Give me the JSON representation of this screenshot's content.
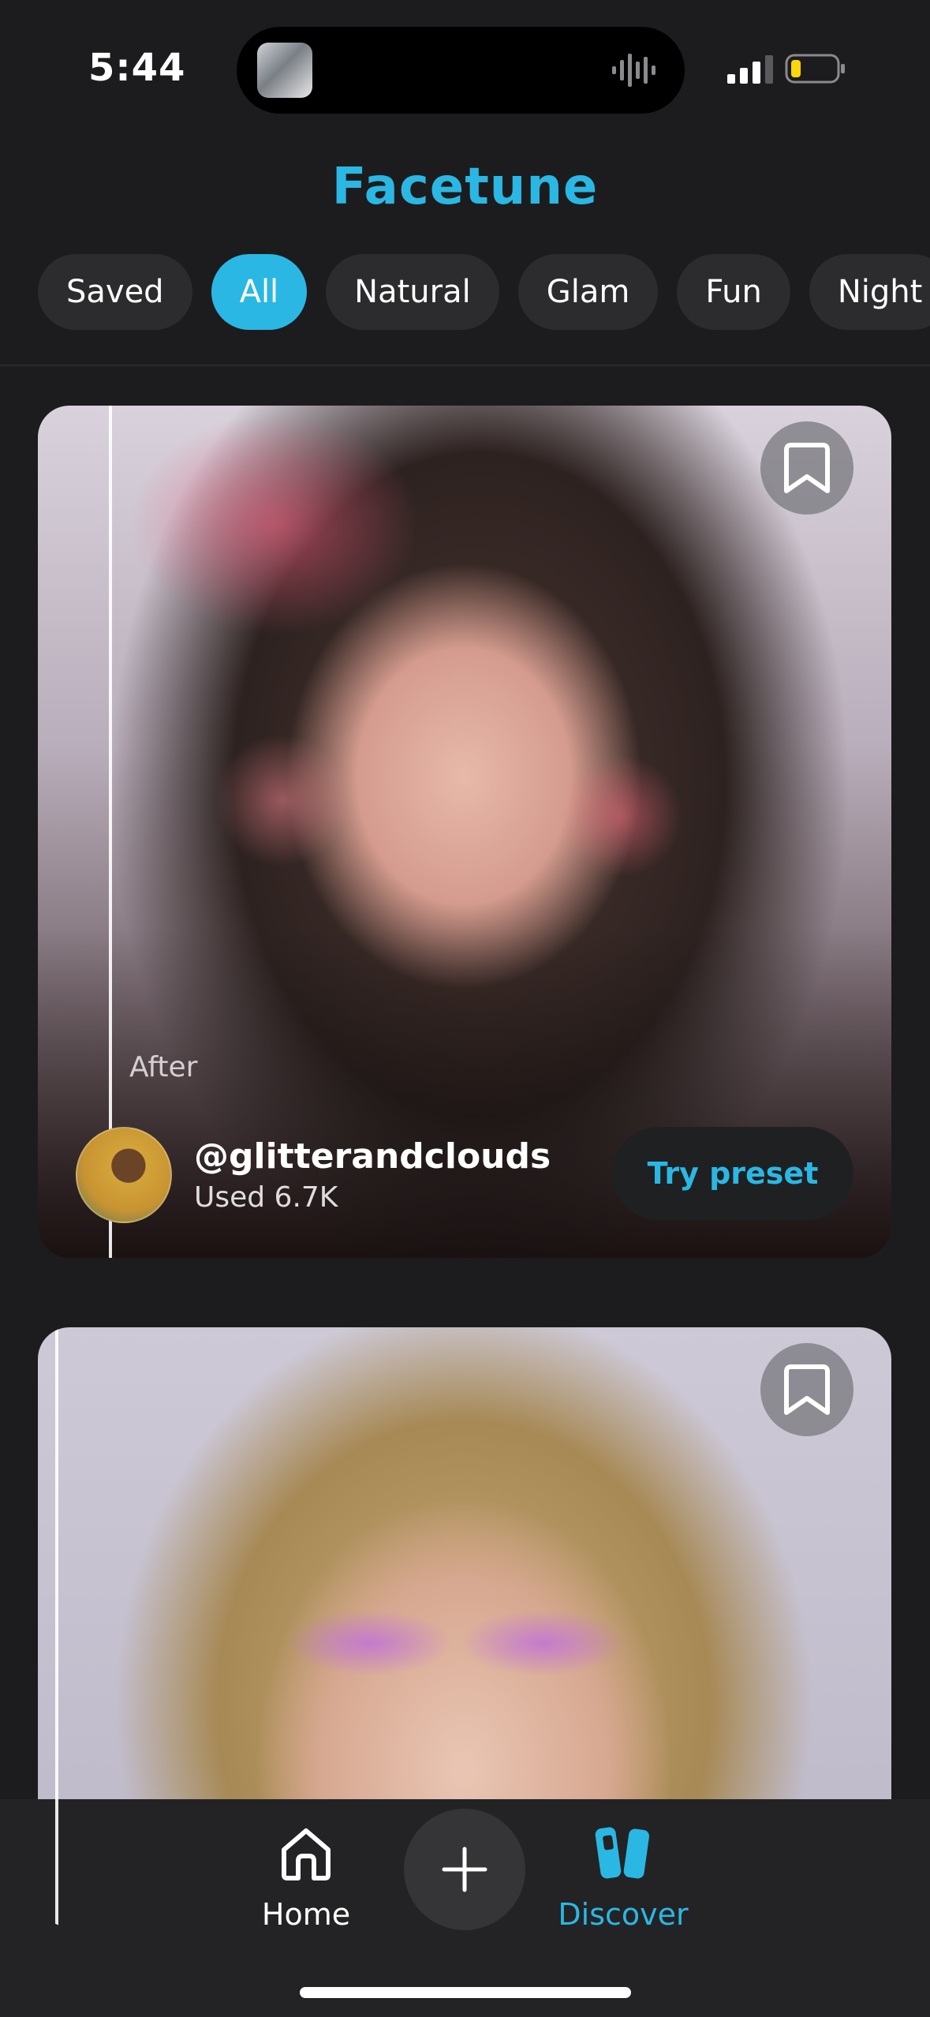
{
  "status_bar": {
    "time": "5:44"
  },
  "app": {
    "title": "Facetune"
  },
  "filters": [
    "Saved",
    "All",
    "Natural",
    "Glam",
    "Fun",
    "Night"
  ],
  "active_filter_index": 1,
  "feed": [
    {
      "label": "After",
      "creator_handle": "@glitterandclouds",
      "usage": "Used 6.7K",
      "action_label": "Try preset"
    },
    {}
  ],
  "tabbar": {
    "home_label": "Home",
    "discover_label": "Discover"
  },
  "colors": {
    "accent": "#2bb7e3",
    "background": "#1c1c1e"
  }
}
